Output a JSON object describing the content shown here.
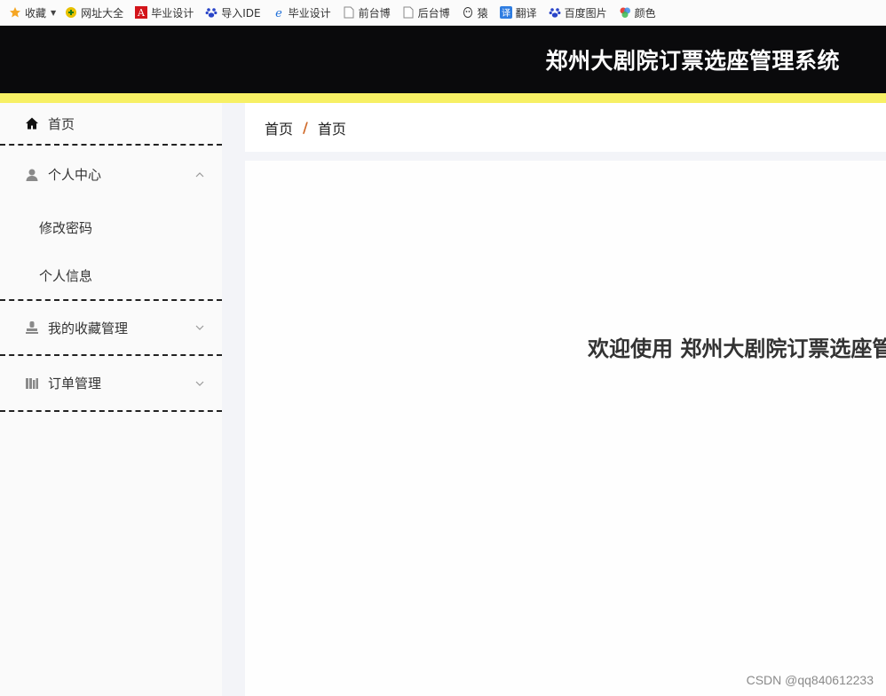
{
  "bookmarks": [
    {
      "icon": "star-icon",
      "label": "收藏",
      "caret": true
    },
    {
      "icon": "site-nav-icon",
      "label": "网址大全"
    },
    {
      "icon": "adobe-icon",
      "label": "毕业设计"
    },
    {
      "icon": "paw-icon",
      "label": "导入IDE"
    },
    {
      "icon": "ie-icon",
      "label": "毕业设计"
    },
    {
      "icon": "page-icon",
      "label": "前台博"
    },
    {
      "icon": "page-icon",
      "label": "后台博"
    },
    {
      "icon": "monkey-icon",
      "label": "猿"
    },
    {
      "icon": "translate-icon",
      "label": "翻译"
    },
    {
      "icon": "paw-icon",
      "label": "百度图片"
    },
    {
      "icon": "color-icon",
      "label": "颜色"
    }
  ],
  "header": {
    "title": "郑州大剧院订票选座管理系统"
  },
  "sidebar": {
    "home": "首页",
    "personal": {
      "label": "个人中心",
      "expanded": true,
      "items": [
        "修改密码",
        "个人信息"
      ]
    },
    "favorites": "我的收藏管理",
    "orders": "订单管理"
  },
  "breadcrumb": {
    "root": "首页",
    "separator": "/",
    "current": "首页"
  },
  "content": {
    "welcome": "欢迎使用 郑州大剧院订票选座管理系统"
  },
  "watermark": "CSDN @qq840612233",
  "colors": {
    "header_bg": "#0a0a0c",
    "accent_bar": "#f7f064",
    "breadcrumb_separator": "#d06a2a"
  }
}
